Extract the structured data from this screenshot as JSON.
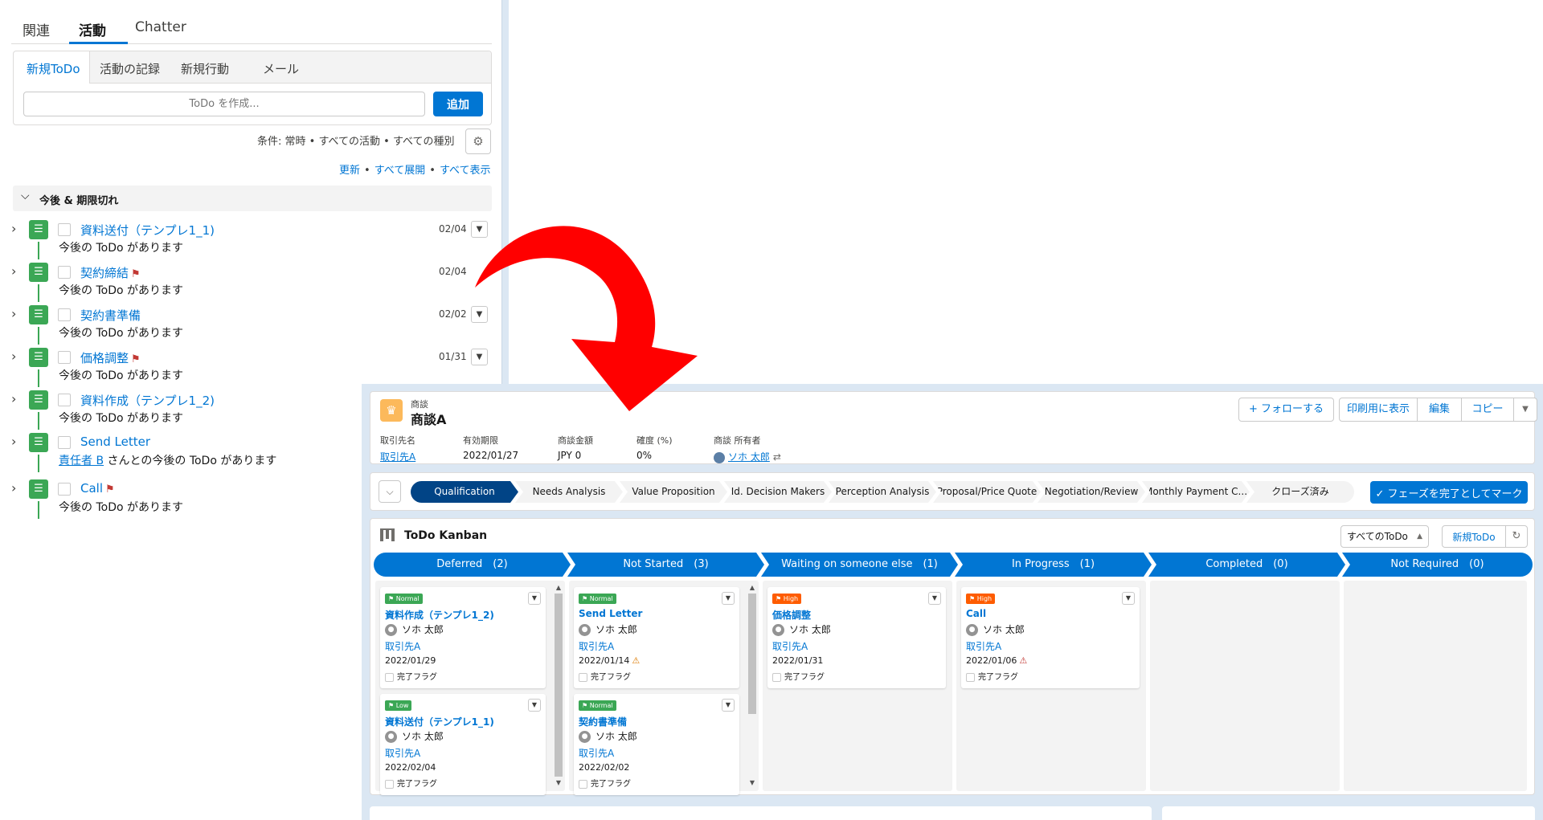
{
  "activity_panel": {
    "tabs": [
      "関連",
      "活動",
      "Chatter"
    ],
    "sub_tabs": [
      "新規ToDo",
      "活動の記録",
      "新規行動",
      "メール"
    ],
    "todo_placeholder": "ToDo を作成...",
    "add_label": "追加",
    "filter_text": "条件: 常時 • すべての活動 • すべての種別",
    "links": [
      "更新",
      "すべて展開",
      "すべて表示"
    ],
    "section_label": "今後 & 期限切れ",
    "items": [
      {
        "title": "資料送付（テンプレ1_1)",
        "subtitle": "今後の ToDo があります",
        "date": "02/04",
        "flag": false
      },
      {
        "title": "契約締結",
        "subtitle": "今後の ToDo があります",
        "date": "02/04",
        "flag": true
      },
      {
        "title": "契約書準備",
        "subtitle": "今後の ToDo があります",
        "date": "02/02",
        "flag": false
      },
      {
        "title": "価格調整",
        "subtitle": "今後の ToDo があります",
        "date": "01/31",
        "flag": true
      },
      {
        "title": "資料作成（テンプレ1_2)",
        "subtitle": "今後の ToDo があります",
        "date": "",
        "flag": false
      },
      {
        "title": "Send Letter",
        "assignee": "責任者 B",
        "subtitle": " さんとの今後の ToDo があります",
        "date": "",
        "flag": false
      },
      {
        "title": "Call",
        "subtitle": "今後の ToDo があります",
        "date": "",
        "flag": true
      }
    ]
  },
  "record": {
    "type_label": "商談",
    "name": "商談A",
    "buttons": [
      "+ フォローする",
      "印刷用に表示",
      "編集",
      "コピー"
    ],
    "fields": [
      {
        "label": "取引先名",
        "value": "取引先A"
      },
      {
        "label": "有効期限",
        "value": "2022/01/27"
      },
      {
        "label": "商談金額",
        "value": "JPY 0"
      },
      {
        "label": "確度 (%)",
        "value": "0%"
      },
      {
        "label": "商談 所有者",
        "value": "ソホ 太郎"
      }
    ]
  },
  "path": {
    "steps": [
      "Qualification",
      "Needs Analysis",
      "Value Proposition",
      "Id. Decision Makers",
      "Perception Analysis",
      "Proposal/Price Quote",
      "Negotiation/Review",
      "Monthly Payment C...",
      "クローズ済み"
    ],
    "current": "Qualification",
    "mark_label": "✓ フェーズを完了としてマーク"
  },
  "kanban": {
    "title": "ToDo Kanban",
    "filter": "すべてのToDo",
    "new_label": "新規ToDo",
    "columns": [
      {
        "label": "Deferred　(2)",
        "cards": [
          {
            "priority": "Normal",
            "title": "資料作成（テンプレ1_2)",
            "owner": "ソホ 太郎",
            "account": "取引先A",
            "due": "2022/01/29",
            "warn": "",
            "done_label": "完了フラグ"
          },
          {
            "priority": "Low",
            "title": "資料送付（テンプレ1_1)",
            "owner": "ソホ 太郎",
            "account": "取引先A",
            "due": "2022/02/04",
            "warn": "",
            "done_label": "完了フラグ"
          }
        ]
      },
      {
        "label": "Not Started　(3)",
        "cards": [
          {
            "priority": "Normal",
            "title": "Send Letter",
            "owner": "ソホ 太郎",
            "account": "取引先A",
            "due": "2022/01/14",
            "warn": "⚠",
            "done_label": "完了フラグ"
          },
          {
            "priority": "Normal",
            "title": "契約書準備",
            "owner": "ソホ 太郎",
            "account": "取引先A",
            "due": "2022/02/02",
            "warn": "",
            "done_label": "完了フラグ"
          }
        ]
      },
      {
        "label": "Waiting on someone else　(1)",
        "cards": [
          {
            "priority": "High",
            "title": "価格調整",
            "owner": "ソホ 太郎",
            "account": "取引先A",
            "due": "2022/01/31",
            "warn": "",
            "done_label": "完了フラグ"
          }
        ]
      },
      {
        "label": "In Progress　(1)",
        "cards": [
          {
            "priority": "High",
            "title": "Call",
            "owner": "ソホ 太郎",
            "account": "取引先A",
            "due": "2022/01/06",
            "warn": "⚠",
            "done_label": "完了フラグ"
          }
        ]
      },
      {
        "label": "Completed　(0)",
        "cards": []
      },
      {
        "label": "Not Required　(0)",
        "cards": []
      }
    ]
  },
  "colors": {
    "brand": "#0176d3",
    "normal": "#3ba755",
    "low": "#3ba755",
    "high": "#fe5c00",
    "warn_yellow": "#dd7a01",
    "warn_red": "#c23934",
    "arrow": "#ff0000"
  }
}
